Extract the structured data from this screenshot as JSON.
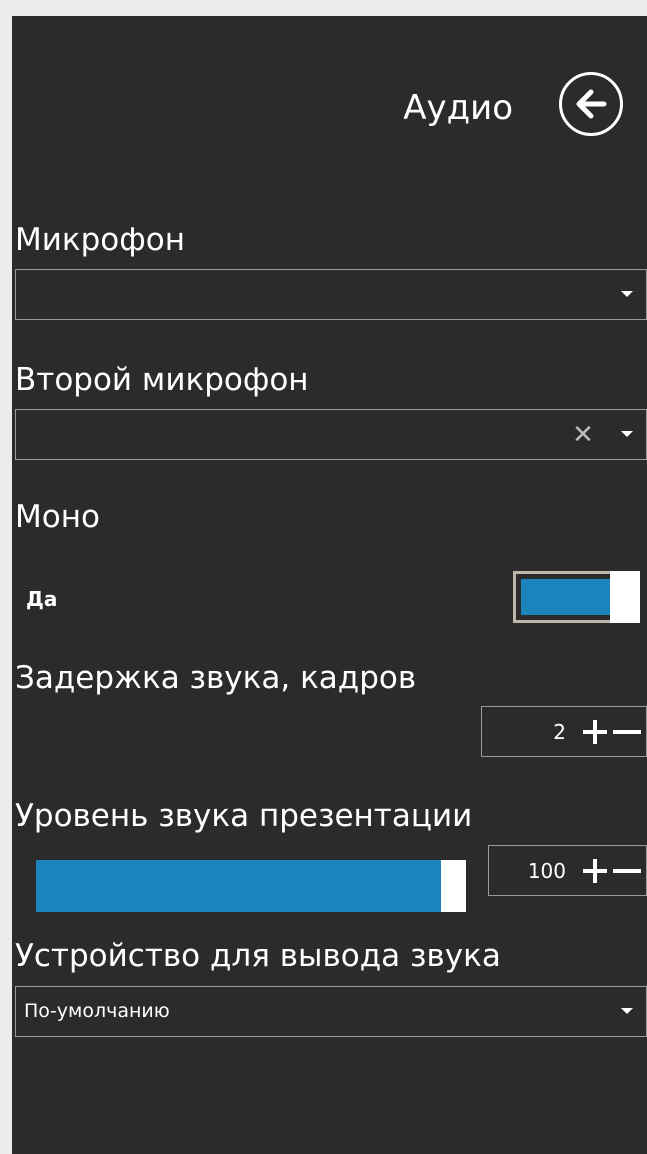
{
  "header": {
    "title": "Аудио",
    "back_icon": "arrow-left-circle-icon"
  },
  "microphone": {
    "label": "Микрофон",
    "value": ""
  },
  "second_microphone": {
    "label": "Второй микрофон",
    "value": "",
    "clear_symbol": "✕"
  },
  "mono": {
    "label": "Моно",
    "value": "Да",
    "enabled": true
  },
  "audio_delay": {
    "label": "Задержка звука, кадров",
    "value": "2"
  },
  "presentation_volume": {
    "label": "Уровень звука презентации",
    "value": "100",
    "level_percent": 100
  },
  "output_device": {
    "label": "Устройство для вывода звука",
    "value": "По-умолчанию"
  },
  "colors": {
    "background": "#2b2b2b",
    "accent": "#1b84bc",
    "border": "#9b9b9b",
    "text": "#ffffff"
  }
}
